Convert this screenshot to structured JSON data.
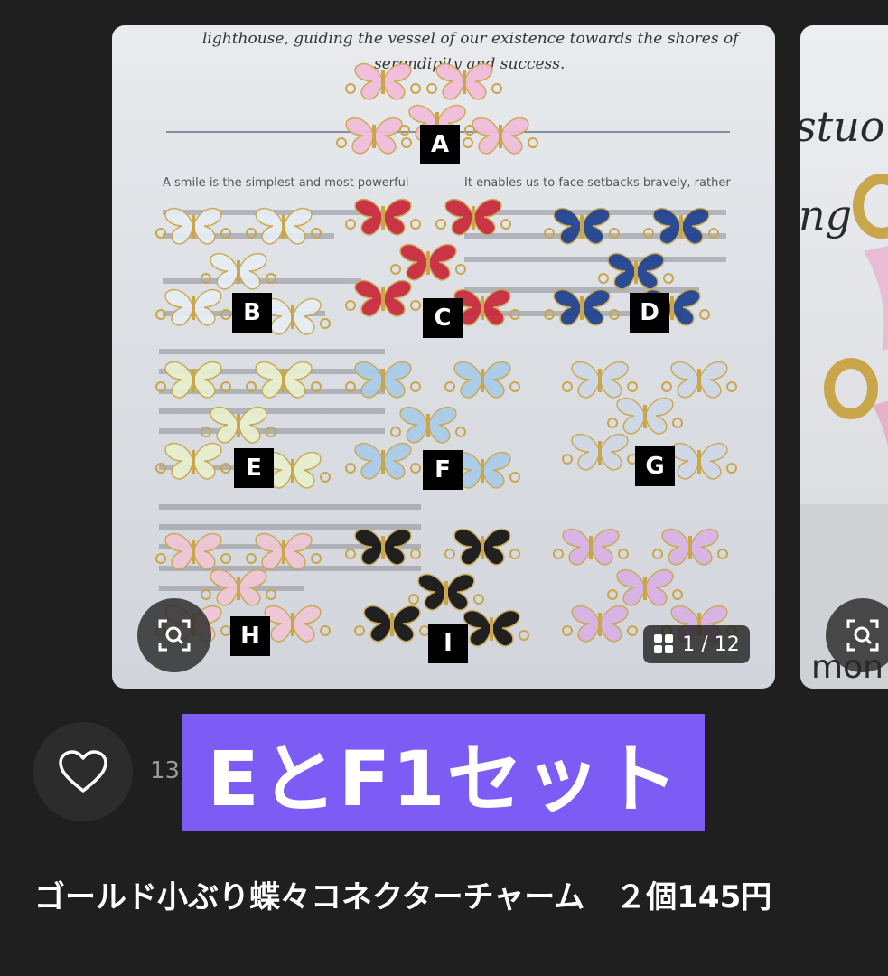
{
  "gallery": {
    "photo_labels": [
      "A",
      "B",
      "C",
      "D",
      "E",
      "F",
      "G",
      "H",
      "I"
    ],
    "photo_text_top": "lighthouse, guiding the vessel of our existence towards the shores of",
    "photo_text_top2": "serendipity and success.",
    "photo_text_left1": "A smile is the simplest and most powerful",
    "photo_text_right1": "It enables us to face setbacks bravely, rather",
    "photo_text_next": "stuo",
    "photo_text_next2": "ng",
    "photo_text_next3": "mon",
    "counter": "1 / 12"
  },
  "like": {
    "count": "13"
  },
  "banner": {
    "text": "EとF1セット"
  },
  "product": {
    "title": "ゴールド小ぶり蝶々コネクターチャーム　２個145円"
  },
  "colors": {
    "background": "#1f1f1f",
    "banner": "#7c5cf5",
    "like_button": "#2c2c2c"
  }
}
